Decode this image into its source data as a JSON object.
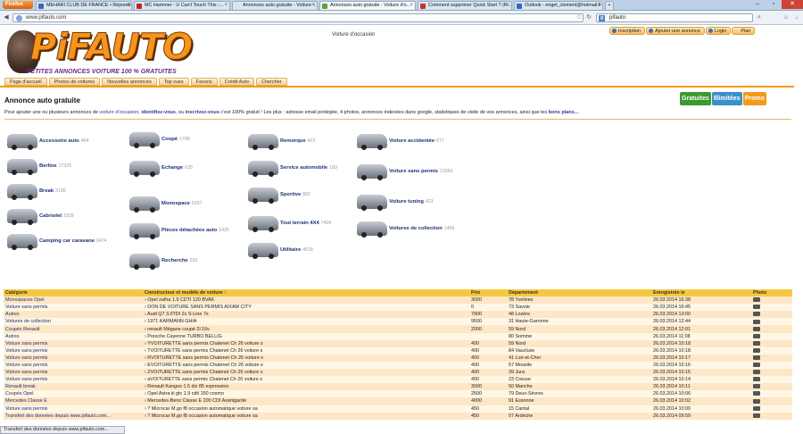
{
  "browser": {
    "menu_label": "Firefox",
    "url": "www.pifauto.com",
    "search_value": "pifauto",
    "search_engine_letter": "g",
    "tabs": [
      {
        "title": "MEHARI CLUB DE FRANCE • Répondre",
        "color": "#3a66c0"
      },
      {
        "title": "MC Hammer - U Can't Touch This -...",
        "color": "#cc2020"
      },
      {
        "title": "Annonces auto gratuite - Voiture :: C...",
        "color": "#e0e0e0"
      },
      {
        "title": "Annonces auto gratuite - Voiture d'o...",
        "color": "#5aa040"
      },
      {
        "title": "Comment supprimer Quick Start ? (R...",
        "color": "#cc3030"
      },
      {
        "title": "Outlook - engel_clement@hotmail.fr",
        "color": "#2a6ac0"
      }
    ],
    "new_tab": "+",
    "window_buttons": [
      "–",
      "▫",
      "✕"
    ]
  },
  "header": {
    "logo_text": "PiFAUTO",
    "slogan": "PETITES ANNONCES VOITURE 100 % GRATUITES",
    "center_text": "Voiture d'occasion",
    "top_links": [
      "Inscription",
      "Ajouter une annonce",
      "Login",
      "Plan"
    ],
    "menu": [
      "Page d'accueil",
      "Photos de voitures",
      "Nouvelles annonces",
      "Top vues",
      "Favoris",
      "Crédit Auto",
      "Chercher"
    ]
  },
  "main": {
    "title": "Annonce auto gratuite",
    "badges": [
      {
        "text": "Gratuites",
        "color": "#3a9a30"
      },
      {
        "text": "Illimitées",
        "color": "#3a90c8"
      },
      {
        "text": "Promo",
        "color": "#f39a1a"
      }
    ],
    "intro_prefix": "Pour ajouter une ou plusieurs annonces de ",
    "intro_link1": "voiture d'occasion",
    "intro_mid1": ", ",
    "intro_link2": "identifiez-vous",
    "intro_mid2": ", ou ",
    "intro_link3": "inscrivez-vous",
    "intro_suffix": " c'est 100% gratuit ! Les plus : adresse email protégée, 4 photos, annonces indexées dans google, statistiques de visite de vos annonces, ainsi que les ",
    "intro_link4": "bons plans..."
  },
  "categories": [
    {
      "label": "Accessoire auto",
      "count": "404"
    },
    {
      "label": "Berline",
      "count": "17325"
    },
    {
      "label": "Break",
      "count": "2136"
    },
    {
      "label": "Cabriolet",
      "count": "1939"
    },
    {
      "label": "Camping car caravane",
      "count": "2474"
    },
    {
      "label": "Coupé",
      "count": "1798"
    },
    {
      "label": "Echange",
      "count": "628"
    },
    {
      "label": "Monospace",
      "count": "5207"
    },
    {
      "label": "Pièces détachées auto",
      "count": "1425"
    },
    {
      "label": "Recherche",
      "count": "220"
    },
    {
      "label": "Remorque",
      "count": "412"
    },
    {
      "label": "Service automobile",
      "count": "193"
    },
    {
      "label": "Sportive",
      "count": "802"
    },
    {
      "label": "Tout terrain 4X4",
      "count": "7404"
    },
    {
      "label": "Utilitaire",
      "count": "4018"
    },
    {
      "label": "Voiture accidentée",
      "count": "677"
    },
    {
      "label": "Voiture sans permis",
      "count": "21859"
    },
    {
      "label": "Voiture tuning",
      "count": "423"
    },
    {
      "label": "Voitures de collection",
      "count": "1406"
    }
  ],
  "table": {
    "headers": [
      "Catégorie",
      "Constructeur et modèle de voiture :",
      "Prix",
      "Département",
      "Enregistrée le",
      "Photo"
    ],
    "rows": [
      [
        "Monospaces Opel",
        "Opel zafira 1.9 CDTI 120 BVA6",
        "3000",
        "78 Yvelines",
        "26.03.2014 16:38"
      ],
      [
        "Voiture sans permis",
        "DON DE VOITURE SANS PERMIS AIXAM CITY",
        "0",
        "73 Savoie",
        "26.03.2014 16:45"
      ],
      [
        "Autres",
        "Audi Q7 3.0TDI 2x S-Line 7s",
        "7900",
        "48 Lozère",
        "26.03.2014 13:00"
      ],
      [
        "Voitures de collection",
        "1971 KARMANN GHIA",
        "9500",
        "31 Haute-Garonne",
        "26.03.2014 12:44"
      ],
      [
        "Coupés Renault",
        "renault Mégane coupé 2l 16v",
        "2000",
        "59 Nord",
        "26.03.2014 12:01"
      ],
      [
        "Autres",
        "Porsche Cayenne TURBO BELLIG",
        "",
        "80 Somme",
        "26.03.2014 11:08"
      ],
      [
        "Voiture sans permis",
        "YVOITURETTE sans permis Chatenet Ch 26 voiture s",
        "400",
        "59 Nord",
        "26.03.2014 10:18"
      ],
      [
        "Voiture sans permis",
        "TVOITURETTE sans permis Chatenet Ch 26 voiture s",
        "400",
        "84 Vaucluse",
        "26.03.2014 10:18"
      ],
      [
        "Voiture sans permis",
        "RVOITURETTE sans permis Chatenet Ch 26 voiture s",
        "400",
        "41 Loir-et-Cher",
        "26.03.2014 10:17"
      ],
      [
        "Voiture sans permis",
        "EVOITURETTE sans permis Chatenet Ch 26 voiture s",
        "400",
        "57 Moselle",
        "26.03.2014 10:16"
      ],
      [
        "Voiture sans permis",
        "ZVOITURETTE sans permis Chatenet Ch 26 voiture s",
        "400",
        "39 Jura",
        "26.03.2014 10:15"
      ],
      [
        "Voiture sans permis",
        "aVOITURETTE sans permis Chatenet Ch 26 voiture s",
        "400",
        "23 Creuse",
        "26.03.2014 10:14"
      ],
      [
        "Renault break",
        "Renault Kangoo 1.5 dci 85 expression",
        "3000",
        "50 Manche",
        "26.03.2014 10:11"
      ],
      [
        "Coupés Opel",
        "Opel Astra iii gtc 1.9 cdti 150 cosmo",
        "2500",
        "79 Deux-Sèvres",
        "26.03.2014 10:06"
      ],
      [
        "Mercedes Classe E",
        "Mercedes-Benz Classe E 200 CDI Avantgarde",
        "4000",
        "91 Essonne",
        "26.03.2014 10:02"
      ],
      [
        "Voiture sans permis",
        "? Microcar M.go f8 occasion automatique voiture sa",
        "450",
        "15 Cantal",
        "26.03.2014 10:00"
      ],
      [
        "Transfert des données depuis www.pifauto.com...",
        "? Microcar M.go f8 occasion automatique voiture sa",
        "450",
        "07 Ardèche",
        "26.03.2014 09:59"
      ]
    ]
  },
  "statusbar": "Transfert des données depuis www.pifauto.com..."
}
